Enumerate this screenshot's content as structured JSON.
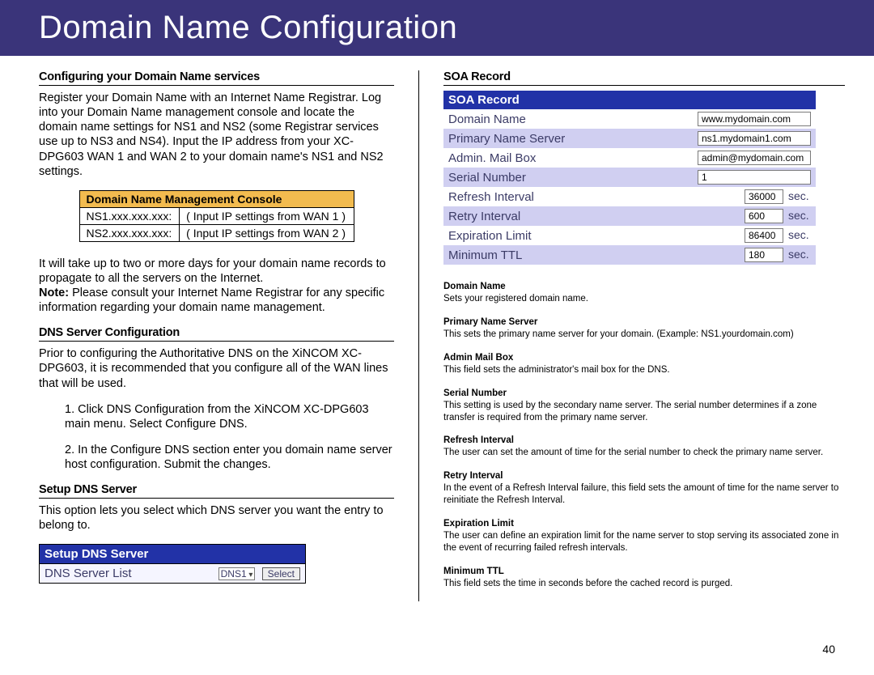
{
  "banner": {
    "title": "Domain Name Configuration"
  },
  "left": {
    "h1": "Configuring your Domain Name services",
    "p1": "Register your Domain Name with an Internet Name Registrar. Log into your Domain Name management console and locate the domain name settings for NS1 and NS2 (some Registrar services use up to NS3 and NS4). Input the IP address from your XC-DPG603 WAN 1 and WAN 2 to your domain name's NS1 and NS2 settings.",
    "console": {
      "title": "Domain Name Management Console",
      "rows": [
        {
          "ns": "NS1.xxx.xxx.xxx:",
          "val": "( Input IP settings from WAN 1 )"
        },
        {
          "ns": "NS2.xxx.xxx.xxx:",
          "val": "( Input IP settings from WAN 2 )"
        }
      ]
    },
    "p2a": "It will take up to two or more days for your domain name records to propagate to all the servers on the Internet.",
    "p2b_label": "Note:",
    "p2b": " Please consult your Internet Name Registrar for any specific information regarding your domain name management.",
    "h2": "DNS Server Configuration",
    "p3": "Prior to configuring the Authoritative DNS on the XiNCOM XC-DPG603, it is recommended that you configure all of the WAN lines that will be used.",
    "step1": "1. Click DNS Configuration from the XiNCOM XC-DPG603 main menu. Select Configure DNS.",
    "step2": "2. In the Configure DNS section enter you domain name server host configuration. Submit the changes.",
    "h3": "Setup DNS Server",
    "p4": "This option lets you select which DNS server you want the entry to belong to.",
    "panel": {
      "title": "Setup DNS Server",
      "row_label": "DNS Server List",
      "select": "DNS1",
      "button": "Select"
    }
  },
  "right": {
    "h1": "SOA Record",
    "soa": {
      "title": "SOA Record",
      "rows": [
        {
          "label": "Domain Name",
          "value": "www.mydomain.com",
          "unit": ""
        },
        {
          "label": "Primary Name Server",
          "value": "ns1.mydomain1.com",
          "unit": ""
        },
        {
          "label": "Admin. Mail Box",
          "value": "admin@mydomain.com",
          "unit": ""
        },
        {
          "label": "Serial Number",
          "value": "1",
          "unit": ""
        },
        {
          "label": "Refresh Interval",
          "value": "36000",
          "unit": "sec."
        },
        {
          "label": "Retry Interval",
          "value": "600",
          "unit": "sec."
        },
        {
          "label": "Expiration Limit",
          "value": "86400",
          "unit": "sec."
        },
        {
          "label": "Minimum TTL",
          "value": "180",
          "unit": "sec."
        }
      ]
    },
    "defs": [
      {
        "term": "Domain Name",
        "desc": "Sets your registered domain name."
      },
      {
        "term": "Primary Name Server",
        "desc": "This sets the primary name server for your domain.  (Example: NS1.yourdomain.com)"
      },
      {
        "term": "Admin Mail Box",
        "desc": "This field sets the administrator's mail box for the DNS."
      },
      {
        "term": "Serial Number",
        "desc": "This setting is used by the secondary name server.  The serial number determines if a zone transfer is required from the primary name server."
      },
      {
        "term": "Refresh Interval",
        "desc": "The user can set the amount of time for the serial number to check the primary name server."
      },
      {
        "term": "Retry Interval",
        "desc": "In the event of a Refresh Interval failure, this field sets the amount of time for the name server to reinitiate the Refresh Interval."
      },
      {
        "term": "Expiration Limit",
        "desc": "The user can define an expiration limit for the name server to stop serving its associated zone in the event of recurring failed refresh intervals."
      },
      {
        "term": "Minimum TTL",
        "desc": "This field sets the time in seconds before the cached record is purged."
      }
    ]
  },
  "page_number": "40"
}
